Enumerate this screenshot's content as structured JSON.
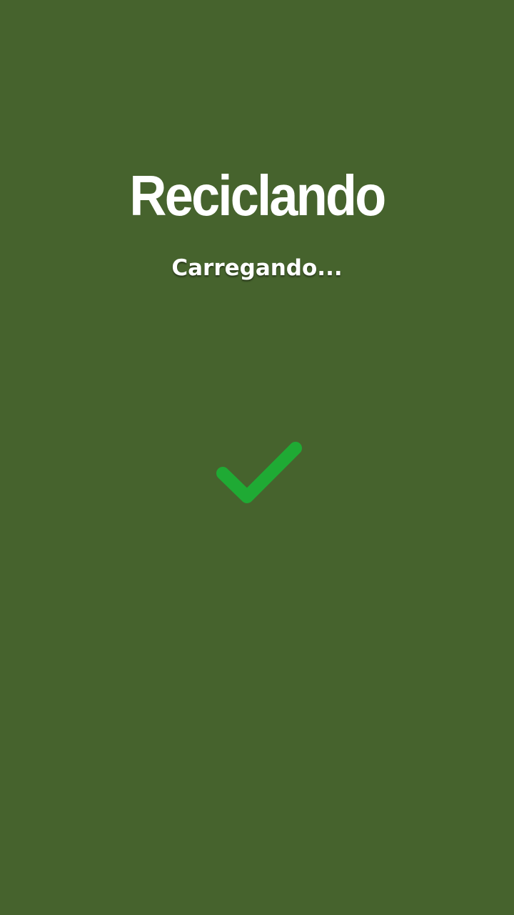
{
  "app": {
    "title": "Reciclando",
    "loading_text": "Carregando..."
  },
  "status": {
    "icon": "check-icon",
    "icon_color": "#1faa34"
  },
  "colors": {
    "background": "#46632d",
    "text": "#ffffff"
  }
}
